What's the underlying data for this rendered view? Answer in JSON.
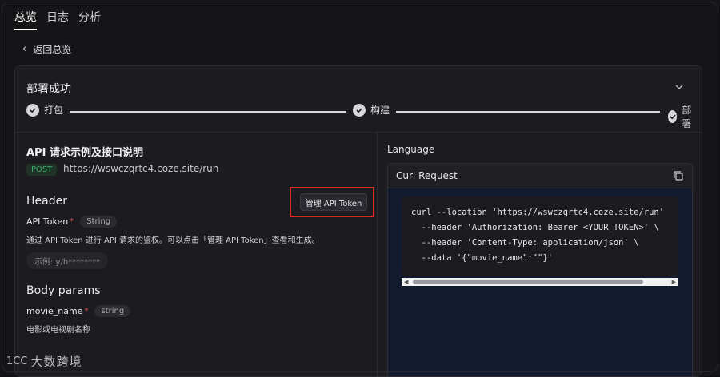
{
  "tabs": [
    {
      "label": "总览",
      "active": true
    },
    {
      "label": "日志",
      "active": false
    },
    {
      "label": "分析",
      "active": false
    }
  ],
  "back_label": "返回总览",
  "deploy": {
    "title": "部署成功",
    "steps": [
      "打包",
      "构建",
      "部署"
    ]
  },
  "api": {
    "title": "API 请求示例及接口说明",
    "method": "POST",
    "url": "https://wswczqrtc4.coze.site/run",
    "header_title": "Header",
    "manage_button": "管理 API Token",
    "token_field": "API Token",
    "token_required": "*",
    "token_type": "String",
    "token_desc": "通过 API Token 进行 API 请求的鉴权。可以点击「管理 API Token」查看和生成。",
    "example": "示例: y/h********",
    "body_title": "Body params",
    "body_field": "movie_name",
    "body_required": "*",
    "body_type": "string",
    "body_desc": "电影或电视剧名称"
  },
  "right": {
    "language_label": "Language",
    "code_title": "Curl Request",
    "code_lines": [
      "curl --location 'https://wswczqrtc4.coze.site/run'",
      "  --header 'Authorization: Bearer <YOUR_TOKEN>' \\",
      "  --header 'Content-Type: application/json' \\",
      "  --data '{\"movie_name\":\"\"}'"
    ]
  },
  "watermark": {
    "logo": "1CC",
    "text": "大数跨境"
  },
  "colors": {
    "accent_red": "#e0262c",
    "post_green": "#3fa86a",
    "code_bg": "#121a2d"
  }
}
